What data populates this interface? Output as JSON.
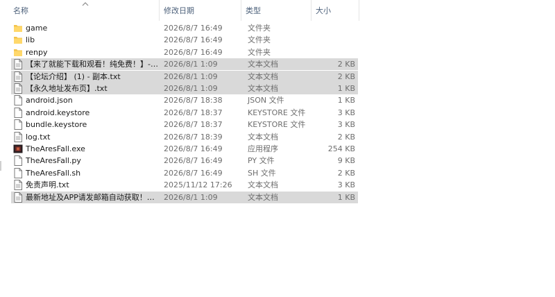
{
  "columns": {
    "name": "名称",
    "date": "修改日期",
    "type": "类型",
    "size": "大小"
  },
  "files": [
    {
      "name": "game",
      "date": "2026/8/7 16:49",
      "type": "文件夹",
      "size": "",
      "icon": "folder-icon",
      "selected": false
    },
    {
      "name": "lib",
      "date": "2026/8/7 16:49",
      "type": "文件夹",
      "size": "",
      "icon": "folder-icon",
      "selected": false
    },
    {
      "name": "renpy",
      "date": "2026/8/7 16:49",
      "type": "文件夹",
      "size": "",
      "icon": "folder-icon",
      "selected": false
    },
    {
      "name": "【来了就能下载和观看！纯免费！】- 副...",
      "date": "2026/8/1 1:09",
      "type": "文本文档",
      "size": "2 KB",
      "icon": "text-file-icon",
      "selected": true
    },
    {
      "name": "【论坛介绍】 (1) - 副本.txt",
      "date": "2026/8/1 1:09",
      "type": "文本文档",
      "size": "2 KB",
      "icon": "text-file-icon",
      "selected": true
    },
    {
      "name": "【永久地址发布页】.txt",
      "date": "2026/8/1 1:09",
      "type": "文本文档",
      "size": "1 KB",
      "icon": "text-file-icon",
      "selected": true
    },
    {
      "name": "android.json",
      "date": "2026/8/7 18:38",
      "type": "JSON 文件",
      "size": "1 KB",
      "icon": "file-icon",
      "selected": false
    },
    {
      "name": "android.keystore",
      "date": "2026/8/7 18:37",
      "type": "KEYSTORE 文件",
      "size": "3 KB",
      "icon": "file-icon",
      "selected": false
    },
    {
      "name": "bundle.keystore",
      "date": "2026/8/7 18:37",
      "type": "KEYSTORE 文件",
      "size": "3 KB",
      "icon": "file-icon",
      "selected": false
    },
    {
      "name": "log.txt",
      "date": "2026/8/7 18:39",
      "type": "文本文档",
      "size": "2 KB",
      "icon": "text-file-icon",
      "selected": false
    },
    {
      "name": "TheAresFall.exe",
      "date": "2026/8/7 16:49",
      "type": "应用程序",
      "size": "254 KB",
      "icon": "app-icon",
      "selected": false
    },
    {
      "name": "TheAresFall.py",
      "date": "2026/8/7 16:49",
      "type": "PY 文件",
      "size": "9 KB",
      "icon": "file-icon",
      "selected": false
    },
    {
      "name": "TheAresFall.sh",
      "date": "2026/8/7 16:49",
      "type": "SH 文件",
      "size": "2 KB",
      "icon": "file-icon",
      "selected": false
    },
    {
      "name": "免责声明.txt",
      "date": "2025/11/12 17:26",
      "type": "文本文档",
      "size": "3 KB",
      "icon": "text-file-icon",
      "selected": false
    },
    {
      "name": "最新地址及APP请发邮箱自动获取！！！...",
      "date": "2026/8/1 1:09",
      "type": "文本文档",
      "size": "1 KB",
      "icon": "text-file-icon",
      "selected": true
    }
  ]
}
